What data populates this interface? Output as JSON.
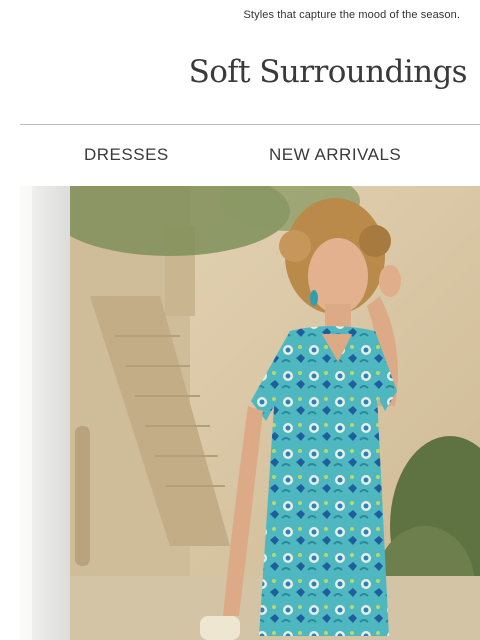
{
  "preheader": {
    "text": "Styles that capture the mood of the season."
  },
  "brand": {
    "name": "Soft Surroundings"
  },
  "nav": {
    "items": [
      {
        "label": "DRESSES"
      },
      {
        "label": "NEW ARRIVALS"
      }
    ]
  },
  "hero": {
    "image": "woman-in-turquoise-print-dress",
    "colors": {
      "stone": "#d9c6a4",
      "dress": "#4fb7c0",
      "foliage": "#6d7f4c"
    }
  }
}
